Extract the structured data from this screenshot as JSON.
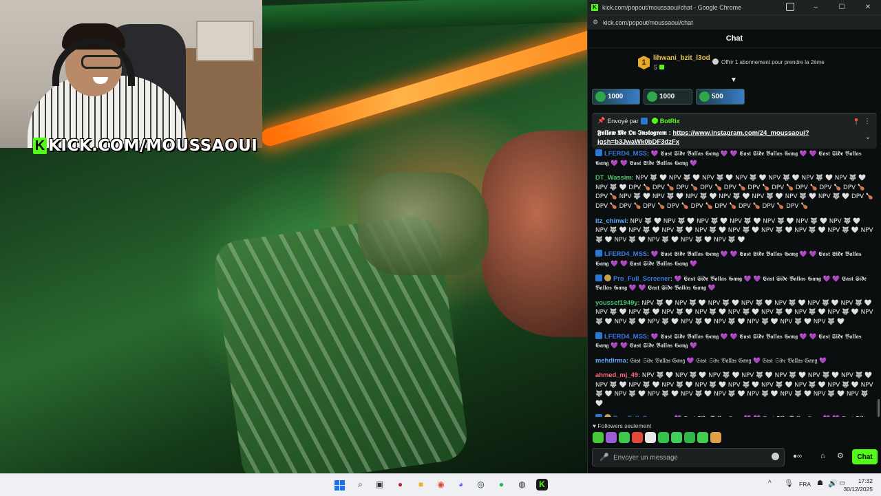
{
  "stream": {
    "watermark_logo": "K",
    "watermark": "KICK.COM/MOUSSAOUI"
  },
  "window": {
    "title": "kick.com/popout/moussaoui/chat - Google Chrome",
    "favicon": "K",
    "url": "kick.com/popout/moussaoui/chat",
    "controls": [
      "–",
      "☐",
      "✕"
    ]
  },
  "chat": {
    "header": "Chat",
    "sub_banner": {
      "badge": "1",
      "user": "lihwani_bzit_l3od",
      "count": "5",
      "gift_text": "Offrir 1 abonnement pour prendre la 2ème"
    },
    "kicks": [
      {
        "amount": "1000"
      },
      {
        "amount": "1000"
      },
      {
        "amount": "500"
      }
    ],
    "pinned": {
      "sent_by": "Envoyé par",
      "bot": "BotRix",
      "text": "𝕱𝖔𝖑𝖑𝖔𝖜 𝕸𝖊 𝕺𝖓 𝕴𝖓𝖘𝖙𝖆𝖌𝖗𝖆𝖒 :",
      "link": "https://www.instagram.com/24_moussaoui?igsh=b3JwaWk0bDF3dzFx"
    },
    "messages": [
      {
        "user": "LFERD4_MSS",
        "color": "#3b7ae0",
        "badge": true,
        "text": ": 💜 𝕰𝖆𝖘𝖙 𝕾𝖎𝖉𝖊 𝕭𝖆𝖑𝖑𝖆𝖘 𝕲𝖆𝖓𝖌 💜 💜 𝕰𝖆𝖘𝖙 𝕾𝖎𝖉𝖊 𝕭𝖆𝖑𝖑𝖆𝖘 𝕲𝖆𝖓𝖌 💜 💜 𝕰𝖆𝖘𝖙 𝕾𝖎𝖉𝖊 𝕭𝖆𝖑𝖑𝖆𝖘 𝕲𝖆𝖓𝖌 💜 💜 𝕰𝖆𝖘𝖙 𝕾𝖎𝖉𝖊 𝕭𝖆𝖑𝖑𝖆𝖘 𝕲𝖆𝖓𝖌 💜"
      },
      {
        "user": "DT_Wassim",
        "color": "#4cc46a",
        "badge": false,
        "text": ": NPV 🐺 🤍 NPV 🐺 🤍 NPV 🐺 🤍 NPV 🐺 🤍 NPV 🐺 🤍 NPV 🐺 🤍 NPV 🐺 🤍 NPV 🐺 🤍 DPV 🍗 DPV 🍗 DPV 🍗 DPV 🍗 DPV 🍗 DPV 🍗 DPV 🍗 DPV 🍗 DPV 🍗 DPV 🍗 DPV 🍗 NPV 🐺 🤍 NPV 🐺 🤍 NPV 🐺 🤍 NPV 🐺 🤍 NPV 🐺 🤍 NPV 🐺 🤍 NPV 🐺 🤍 DPV 🍗 DPV 🍗 DPV 🍗 DPV 🍗 DPV 🍗 DPV 🍗 DPV 🍗 DPV 🍗 DPV 🍗 DPV 🍗"
      },
      {
        "user": "itz_chinwi",
        "color": "#5fa8ff",
        "badge": false,
        "text": ": NPV 🐺 🤍 NPV 🐺 🤍 NPV 🐺 🤍 NPV 🐺 🤍 NPV 🐺 🤍 NPV 🐺 🤍 NPV 🐺 🤍 NPV 🐺 🤍 NPV 🐺 🤍 NPV 🐺 🤍 NPV 🐺 🤍 NPV 🐺 🤍 NPV 🐺 🤍 NPV 🐺 🤍 NPV 🐺 🤍 NPV 🐺 🤍 NPV 🐺 🤍 NPV 🐺 🤍 NPV 🐺 🤍 NPV 🐺 🤍"
      },
      {
        "user": "LFERD4_MSS",
        "color": "#3b7ae0",
        "badge": true,
        "text": ": 💜 𝕰𝖆𝖘𝖙 𝕾𝖎𝖉𝖊 𝕭𝖆𝖑𝖑𝖆𝖘 𝕲𝖆𝖓𝖌 💜 💜 𝕰𝖆𝖘𝖙 𝕾𝖎𝖉𝖊 𝕭𝖆𝖑𝖑𝖆𝖘 𝕲𝖆𝖓𝖌 💜 💜 𝕰𝖆𝖘𝖙 𝕾𝖎𝖉𝖊 𝕭𝖆𝖑𝖑𝖆𝖘 𝕲𝖆𝖓𝖌 💜 💜 𝕰𝖆𝖘𝖙 𝕾𝖎𝖉𝖊 𝕭𝖆𝖑𝖑𝖆𝖘 𝕲𝖆𝖓𝖌 💜"
      },
      {
        "user": "Pro_Full_Screener",
        "color": "#3b7ae0",
        "badge": true,
        "og": true,
        "text": ": 💜 𝕰𝖆𝖘𝖙 𝕾𝖎𝖉𝖊 𝕭𝖆𝖑𝖑𝖆𝖘 𝕲𝖆𝖓𝖌 💜 💜 𝕰𝖆𝖘𝖙 𝕾𝖎𝖉𝖊 𝕭𝖆𝖑𝖑𝖆𝖘 𝕲𝖆𝖓𝖌 💜 💜 𝕰𝖆𝖘𝖙 𝕾𝖎𝖉𝖊 𝕭𝖆𝖑𝖑𝖆𝖘 𝕲𝖆𝖓𝖌 💜 💜 𝕰𝖆𝖘𝖙 𝕾𝖎𝖉𝖊 𝕭𝖆𝖑𝖑𝖆𝖘 𝕲𝖆𝖓𝖌 💜"
      },
      {
        "user": "youssef1949y",
        "color": "#4cc46a",
        "badge": false,
        "text": ": NPV 🐺 🤍 NPV 🐺 🤍 NPV 🐺 🤍 NPV 🐺 🤍 NPV 🐺 🤍 NPV 🐺 🤍 NPV 🐺 🤍 NPV 🐺 🤍 NPV 🐺 🤍 NPV 🐺 🤍 NPV 🐺 🤍 NPV 🐺 🤍 NPV 🐺 🤍 NPV 🐺 🤍 NPV 🐺 🤍 NPV 🐺 🤍 NPV 🐺 🤍 NPV 🐺 🤍 NPV 🐺 🤍 NPV 🐺 🤍 NPV 🐺 🤍 NPV 🐺 🤍 NPV 🐺 🤍"
      },
      {
        "user": "LFERD4_MSS",
        "color": "#3b7ae0",
        "badge": true,
        "text": ": 💜 𝕰𝖆𝖘𝖙 𝕾𝖎𝖉𝖊 𝕭𝖆𝖑𝖑𝖆𝖘 𝕲𝖆𝖓𝖌 💜 💜 𝕰𝖆𝖘𝖙 𝕾𝖎𝖉𝖊 𝕭𝖆𝖑𝖑𝖆𝖘 𝕲𝖆𝖓𝖌 💜 💜 𝕰𝖆𝖘𝖙 𝕾𝖎𝖉𝖊 𝕭𝖆𝖑𝖑𝖆𝖘 𝕲𝖆𝖓𝖌 💜 💜 𝕰𝖆𝖘𝖙 𝕾𝖎𝖉𝖊 𝕭𝖆𝖑𝖑𝖆𝖘 𝕲𝖆𝖓𝖌 💜"
      },
      {
        "user": "mehdirma",
        "color": "#5fa8ff",
        "badge": false,
        "text": ": 𝔈𝔞𝔰𝔱 𝔖𝔦𝔡𝔢 𝔅𝔞𝔩𝔩𝔞𝔰 𝔊𝔞𝔫𝔤 💜 𝔈𝔞𝔰𝔱 𝔖𝔦𝔡𝔢 𝔅𝔞𝔩𝔩𝔞𝔰 𝔊𝔞𝔫𝔤 💜 𝔈𝔞𝔰𝔱 𝔖𝔦𝔡𝔢 𝔅𝔞𝔩𝔩𝔞𝔰 𝔊𝔞𝔫𝔤 💜"
      },
      {
        "user": "ahmed_mj_49",
        "color": "#ff6b7a",
        "badge": false,
        "text": ": NPV 🐺 🤍 NPV 🐺 🤍 NPV 🐺 🤍 NPV 🐺 🤍 NPV 🐺 🤍 NPV 🐺 🤍 NPV 🐺 🤍 NPV 🐺 🤍 NPV 🐺 🤍 NPV 🐺 🤍 NPV 🐺 🤍 NPV 🐺 🤍 NPV 🐺 🤍 NPV 🐺 🤍 NPV 🐺 🤍 NPV 🐺 🤍 NPV 🐺 🤍 NPV 🐺 🤍 NPV 🐺 🤍 NPV 🐺 🤍 NPV 🐺 🤍 NPV 🐺 🤍 NPV 🐺 🤍 NPV 🐺 🤍"
      },
      {
        "user": "Pro_Full_Screener",
        "color": "#3b7ae0",
        "badge": true,
        "og": true,
        "text": ": 💜 𝕰𝖆𝖘𝖙 𝕾𝖎𝖉𝖊 𝕭𝖆𝖑𝖑𝖆𝖘 𝕲𝖆𝖓𝖌 💜 💜 𝕰𝖆𝖘𝖙 𝕾𝖎𝖉𝖊 𝕭𝖆𝖑𝖑𝖆𝖘 𝕲𝖆𝖓𝖌 💜 💜 𝕰𝖆𝖘𝖙 𝕾𝖎𝖉𝖊 𝕭𝖆𝖑𝖑𝖆𝖘 𝕲𝖆𝖓𝖌 💜 💜 𝕰𝖆𝖘𝖙 𝕾𝖎𝖉𝖊 𝕭𝖆𝖑𝖑𝖆𝖘 𝕲𝖆𝖓𝖌 💜"
      }
    ],
    "followers_only": "♥ Followers seulement",
    "emote_colors": [
      "#46c83a",
      "#9b5cd6",
      "#3ec84a",
      "#e04a3a",
      "#e8e8e8",
      "#36c14c",
      "#3ed05a",
      "#2eb84a",
      "#44d04e",
      "#e0a04a"
    ],
    "input_placeholder": "Envoyer un message",
    "send_label": "Chat"
  },
  "taskbar": {
    "apps": [
      {
        "name": "search-icon",
        "glyph": "⌕",
        "color": "#222"
      },
      {
        "name": "task-view-icon",
        "glyph": "▣",
        "color": "#333"
      },
      {
        "name": "app-red-icon",
        "glyph": "●",
        "color": "#c0282e"
      },
      {
        "name": "file-explorer-icon",
        "glyph": "■",
        "color": "#e7b534"
      },
      {
        "name": "chrome-icon",
        "glyph": "◉",
        "color": "#db4437"
      },
      {
        "name": "discord-icon",
        "glyph": "◕",
        "color": "#5865f2"
      },
      {
        "name": "steam-icon",
        "glyph": "◎",
        "color": "#1b2838"
      },
      {
        "name": "spotify-icon",
        "glyph": "●",
        "color": "#1db954"
      },
      {
        "name": "obs-icon",
        "glyph": "◍",
        "color": "#302e31"
      },
      {
        "name": "kick-app-icon",
        "glyph": "K",
        "color": "#53fc18"
      }
    ],
    "tray_chevron": "^",
    "lang": "FRA",
    "time": "17:32",
    "date": "30/12/2025"
  }
}
